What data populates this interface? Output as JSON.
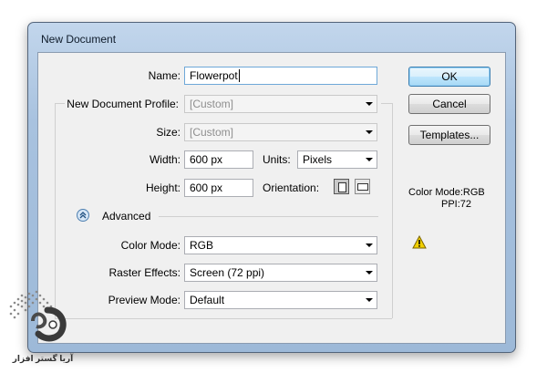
{
  "window": {
    "title": "New Document"
  },
  "form": {
    "name_label": "Name:",
    "name_value": "Flowerpot",
    "profile_label": "New Document Profile:",
    "profile_value": "[Custom]",
    "size_label": "Size:",
    "size_value": "[Custom]",
    "width_label": "Width:",
    "width_value": "600 px",
    "units_label": "Units:",
    "units_value": "Pixels",
    "height_label": "Height:",
    "height_value": "600 px",
    "orientation_label": "Orientation:",
    "advanced_label": "Advanced",
    "color_mode_label": "Color Mode:",
    "color_mode_value": "RGB",
    "raster_label": "Raster Effects:",
    "raster_value": "Screen (72 ppi)",
    "preview_label": "Preview Mode:",
    "preview_value": "Default"
  },
  "buttons": {
    "ok": "OK",
    "cancel": "Cancel",
    "templates": "Templates..."
  },
  "info": {
    "color_mode": "Color Mode:RGB",
    "ppi": "PPI:72"
  },
  "watermark": {
    "text": "آریا گستر افزار"
  },
  "icons": [
    "warning-icon",
    "chevron-up-icon",
    "portrait-icon",
    "landscape-icon",
    "dropdown-arrow-icon"
  ],
  "colors": {
    "title_bar": "#a8c2df",
    "default_button": "#bee6fd",
    "warning": "#f2d000"
  }
}
